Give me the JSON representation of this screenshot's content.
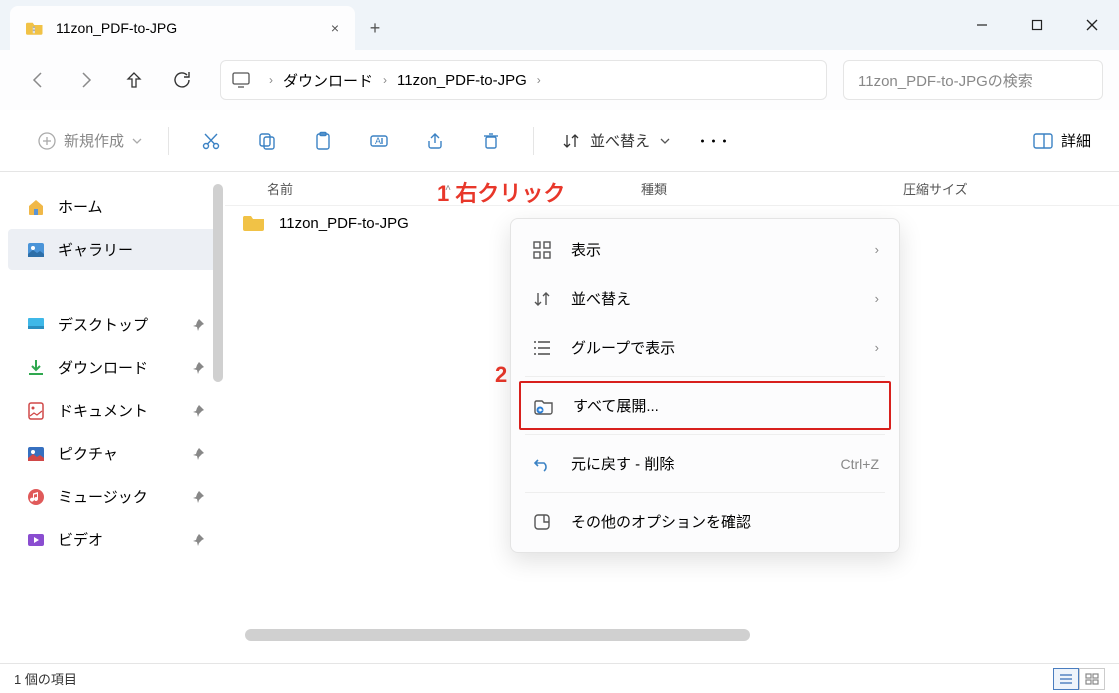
{
  "titlebar": {
    "tab_title": "11zon_PDF-to-JPG",
    "close_glyph": "×",
    "newtab_glyph": "+"
  },
  "breadcrumb": {
    "segments": [
      "ダウンロード",
      "11zon_PDF-to-JPG"
    ],
    "sep": "›"
  },
  "search": {
    "placeholder": "11zon_PDF-to-JPGの検索"
  },
  "toolbar": {
    "new_label": "新規作成",
    "sort_label": "並べ替え",
    "detail_label": "詳細",
    "more_glyph": "･･･"
  },
  "sidebar": {
    "home": "ホーム",
    "gallery": "ギャラリー",
    "items": [
      {
        "label": "デスクトップ"
      },
      {
        "label": "ダウンロード"
      },
      {
        "label": "ドキュメント"
      },
      {
        "label": "ピクチャ"
      },
      {
        "label": "ミュージック"
      },
      {
        "label": "ビデオ"
      }
    ],
    "pin_glyph": "📌"
  },
  "columns": {
    "name": "名前",
    "type": "種類",
    "size": "圧縮サイズ",
    "sort_glyph": "˄"
  },
  "rows": [
    {
      "name": "11zon_PDF-to-JPG"
    }
  ],
  "annotations": {
    "a1": "1 右クリック",
    "a2": "2"
  },
  "context_menu": {
    "view": "表示",
    "sort": "並べ替え",
    "group": "グループで表示",
    "extract": "すべて展開...",
    "undo": "元に戻す - 削除",
    "undo_shortcut": "Ctrl+Z",
    "more": "その他のオプションを確認",
    "chevron": "›"
  },
  "statusbar": {
    "count": "1 個の項目"
  }
}
